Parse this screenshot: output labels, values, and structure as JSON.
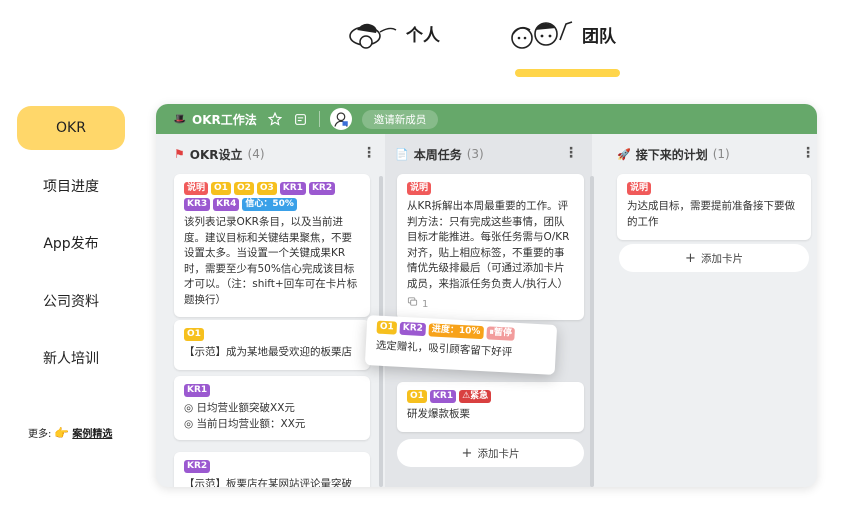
{
  "modes": {
    "personal": "个人",
    "team": "团队"
  },
  "nav": {
    "items": [
      "OKR",
      "项目进度",
      "App发布",
      "公司资料",
      "新人培训"
    ],
    "more_label": "更多:",
    "more_link": "案例精选"
  },
  "board": {
    "title": "OKR工作法",
    "invite": "邀请新成员",
    "columns": [
      {
        "title": "OKR设立",
        "count": "(4)"
      },
      {
        "title": "本周任务",
        "count": "(3)"
      },
      {
        "title": "接下来的计划",
        "count": "(1)"
      }
    ],
    "col1_cards": [
      {
        "tags": [
          "说明",
          "O1",
          "O2",
          "O3",
          "KR1",
          "KR2",
          "KR3",
          "KR4",
          "信心：50%"
        ],
        "text": "该列表记录OKR条目，以及当前进度。建议目标和关键结果聚焦，不要设置太多。当设置一个关键成果KR时，需要至少有50%信心完成该目标才可以。（注：shift+回车可在卡片标题换行）"
      },
      {
        "tags": [
          "O1"
        ],
        "text": "【示范】成为某地最受欢迎的板栗店"
      },
      {
        "tags": [
          "KR1"
        ],
        "line1": "◎ 日均营业额突破XX元",
        "line2": "◎ 当前日均营业额：XX元"
      },
      {
        "tags": [
          "KR2"
        ],
        "text": "【示范】板栗店在某网站评论量突破"
      }
    ],
    "col2_cards": [
      {
        "tags": [
          "说明"
        ],
        "text": "从KR拆解出本周最重要的工作。评判方法：只有完成这些事情，团队目标才能推进。每张任务需与O/KR对齐，贴上相应标签，不重要的事情优先级排最后（可通过添加卡片成员，来指派任务负责人/执行人）",
        "comments": "1"
      },
      {
        "tags": [
          "O1",
          "KR1",
          "紧急"
        ],
        "text": "研发爆款板栗"
      }
    ],
    "col3_cards": [
      {
        "tags": [
          "说明"
        ],
        "text": "为达成目标，需要提前准备接下要做的工作"
      }
    ],
    "drag_card": {
      "tags": [
        "O1",
        "KR2",
        "进度：10%",
        "暂停"
      ],
      "text": "选定赠礼，吸引顾客留下好评"
    },
    "add_card": "添加卡片"
  }
}
